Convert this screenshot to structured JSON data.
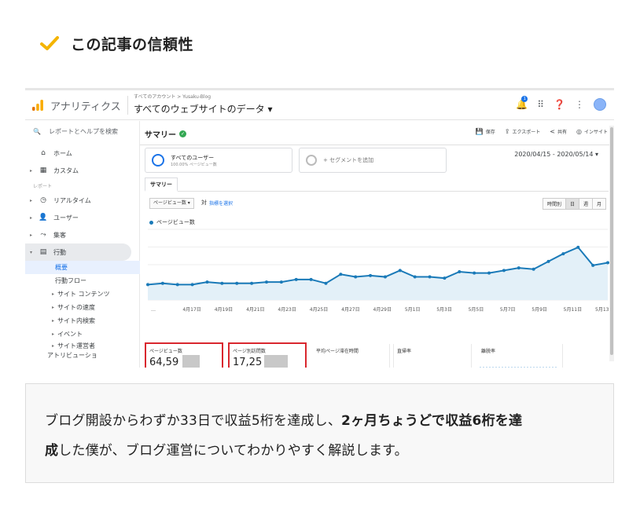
{
  "heading": {
    "title": "この記事の信頼性",
    "check_color": "#f4b400"
  },
  "ga": {
    "app_name": "アナリティクス",
    "breadcrumb": "すべてのアカウント > Yusaku-Blog",
    "property": "すべてのウェブサイトのデータ ▾",
    "notif_count": "1",
    "search_placeholder": "レポートとヘルプを検索",
    "nav": {
      "home": "ホーム",
      "custom": "カスタム",
      "reports_section": "レポート",
      "realtime": "リアルタイム",
      "user": "ユーザー",
      "acquisition": "集客",
      "behavior": "行動",
      "overview": "概要",
      "behavior_flow": "行動フロー",
      "site_content": "サイト コンテンツ",
      "site_speed": "サイトの速度",
      "site_search": "サイト内検索",
      "events": "イベント",
      "experiments": "サイト運営者",
      "attribution": "アトリビューショ"
    },
    "main": {
      "title": "サマリー",
      "actions": {
        "save": "保存",
        "export": "エクスポート",
        "share": "共有",
        "insight": "インサイト"
      },
      "segment1_title": "すべてのユーザー",
      "segment1_sub": "100.00% ページビュー数",
      "segment2_title": "+ セグメントを追加",
      "date_range": "2020/04/15 - 2020/05/14 ▾",
      "tab": "サマリー",
      "metric_select": "ページビュー数 ▾",
      "vs": "対",
      "pick_metric": "指標を選択",
      "granularity": [
        "時間別",
        "日",
        "週",
        "月"
      ],
      "legend": "ページビュー数"
    },
    "metrics": {
      "pageviews_label": "ページビュー数",
      "pageviews_value": "64,59",
      "pps_label": "ページ別訪問数",
      "pps_value": "17,25",
      "avg_time_label": "平均ページ滞在時間",
      "bounce_label": "直帰率",
      "exit_label": "離脱率"
    }
  },
  "chart_data": {
    "type": "line",
    "categories": [
      "…",
      "4月17日",
      "4月19日",
      "4月21日",
      "4月23日",
      "4月25日",
      "4月27日",
      "4月29日",
      "5月1日",
      "5月3日",
      "5月5日",
      "5月7日",
      "5月9日",
      "5月11日",
      "5月13日"
    ],
    "x_tick_labels": [
      "…",
      "4月17日",
      "4月19日",
      "4月21日",
      "4月23日",
      "4月25日",
      "4月27日",
      "4月29日",
      "5月1日",
      "5月3日",
      "5月5日",
      "5月7日",
      "5月9日",
      "5月11日",
      "5月13日"
    ],
    "series": [
      {
        "name": "ページビュー数",
        "color": "#1a7ab8",
        "values": [
          12,
          13,
          12,
          12,
          14,
          13,
          13,
          13,
          14,
          14,
          16,
          16,
          13,
          20,
          18,
          19,
          18,
          23,
          18,
          18,
          17,
          22,
          21,
          21,
          23,
          25,
          24,
          30,
          36,
          41,
          27,
          29
        ]
      }
    ],
    "ylim": [
      0,
      55
    ],
    "grid": true,
    "legend": "top-left"
  },
  "callout": {
    "part1": "ブログ開設からわずか33日で収益5桁を達成し、",
    "bold1": "2ヶ月ちょうどで収益6桁を達",
    "bold2": "成",
    "part2": "した僕が、ブログ運営についてわかりやすく解説します。"
  }
}
